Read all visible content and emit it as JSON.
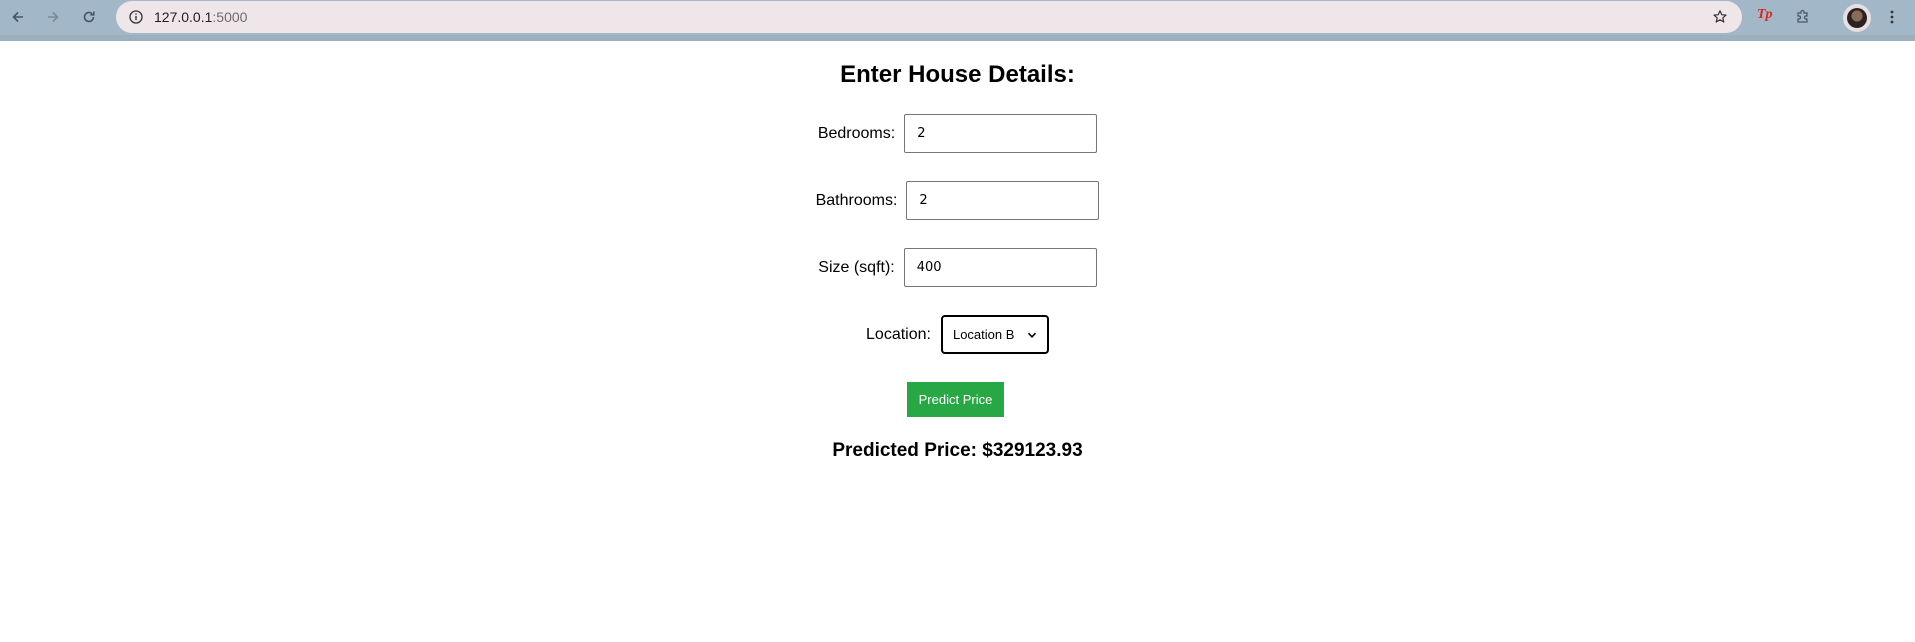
{
  "browser": {
    "url_host": "127.0.0.1",
    "url_port": ":5000",
    "extension_label": "Tp"
  },
  "form": {
    "title": "Enter House Details:",
    "bedrooms": {
      "label": "Bedrooms:",
      "value": "2"
    },
    "bathrooms": {
      "label": "Bathrooms:",
      "value": "2"
    },
    "size": {
      "label": "Size (sqft):",
      "value": "400"
    },
    "location": {
      "label": "Location:",
      "selected": "Location B"
    },
    "submit_label": "Predict Price"
  },
  "result": {
    "text": "Predicted Price: $329123.93"
  },
  "colors": {
    "button_bg": "#28a745",
    "toolbar_bg": "#a2b8c9",
    "omnibox_bg": "#efe6ea"
  },
  "icons": [
    "back-icon",
    "forward-icon",
    "reload-icon",
    "site-info-icon",
    "bookmark-star-icon",
    "extension-puzzle-icon",
    "profile-avatar",
    "more-menu-icon",
    "chevron-down-icon"
  ]
}
